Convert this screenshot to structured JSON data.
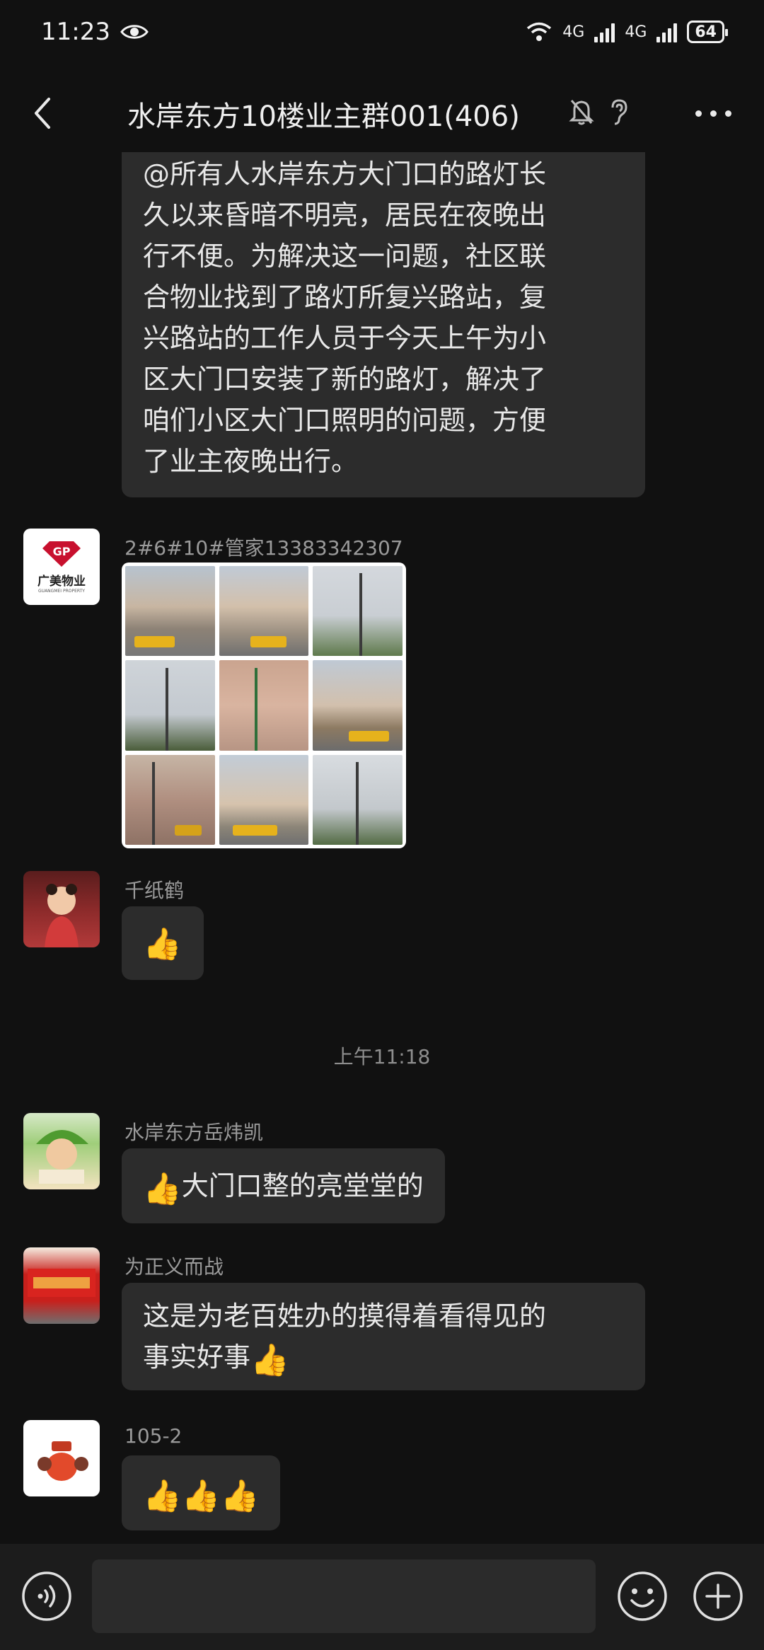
{
  "status_bar": {
    "time": "11:23",
    "net1": "4G",
    "net2": "4G",
    "battery": "64"
  },
  "header": {
    "title": "水岸东方10楼业主群001(406)"
  },
  "messages": {
    "m0_lines": [
      "@所有人水岸东方大门口的路灯长",
      "久以来昏暗不明亮，居民在夜晚出",
      "行不便。为解决这一问题，社区联",
      "合物业找到了路灯所复兴路站，复",
      "兴路站的工作人员于今天上午为小",
      "区大门口安装了新的路灯，解决了",
      "咱们小区大门口照明的问题，方便",
      "了业主夜晚出行。"
    ],
    "m1_sender": "2#6#10#管家13383342307",
    "m1_avatar_text": "广美物业",
    "m1_avatar_sub": "GUANGMEI PROPERTY",
    "m2_sender": "千纸鹤",
    "m2_text": "👍",
    "timestamp": "上午11:18",
    "m3_sender": "水岸东方岳炜凯",
    "m3_text": "大门口整的亮堂堂的",
    "m4_sender": "为正义而战",
    "m4_line1": "这是为老百姓办的摸得着看得见的",
    "m4_line2": "事实好事",
    "m5_sender": "105-2",
    "m5_text": "👍👍👍"
  },
  "icons": {
    "back": "back-arrow-icon",
    "mute": "bell-off-icon",
    "ear": "earpiece-icon",
    "more": "more-dots-icon",
    "voice": "voice-icon",
    "emoji": "emoji-icon",
    "plus": "plus-icon"
  },
  "colors": {
    "background": "#111111",
    "bubble": "#2c2c2c",
    "text": "#e8e8e8",
    "meta": "#9a9a9a",
    "input_bar": "#1c1c1c"
  }
}
